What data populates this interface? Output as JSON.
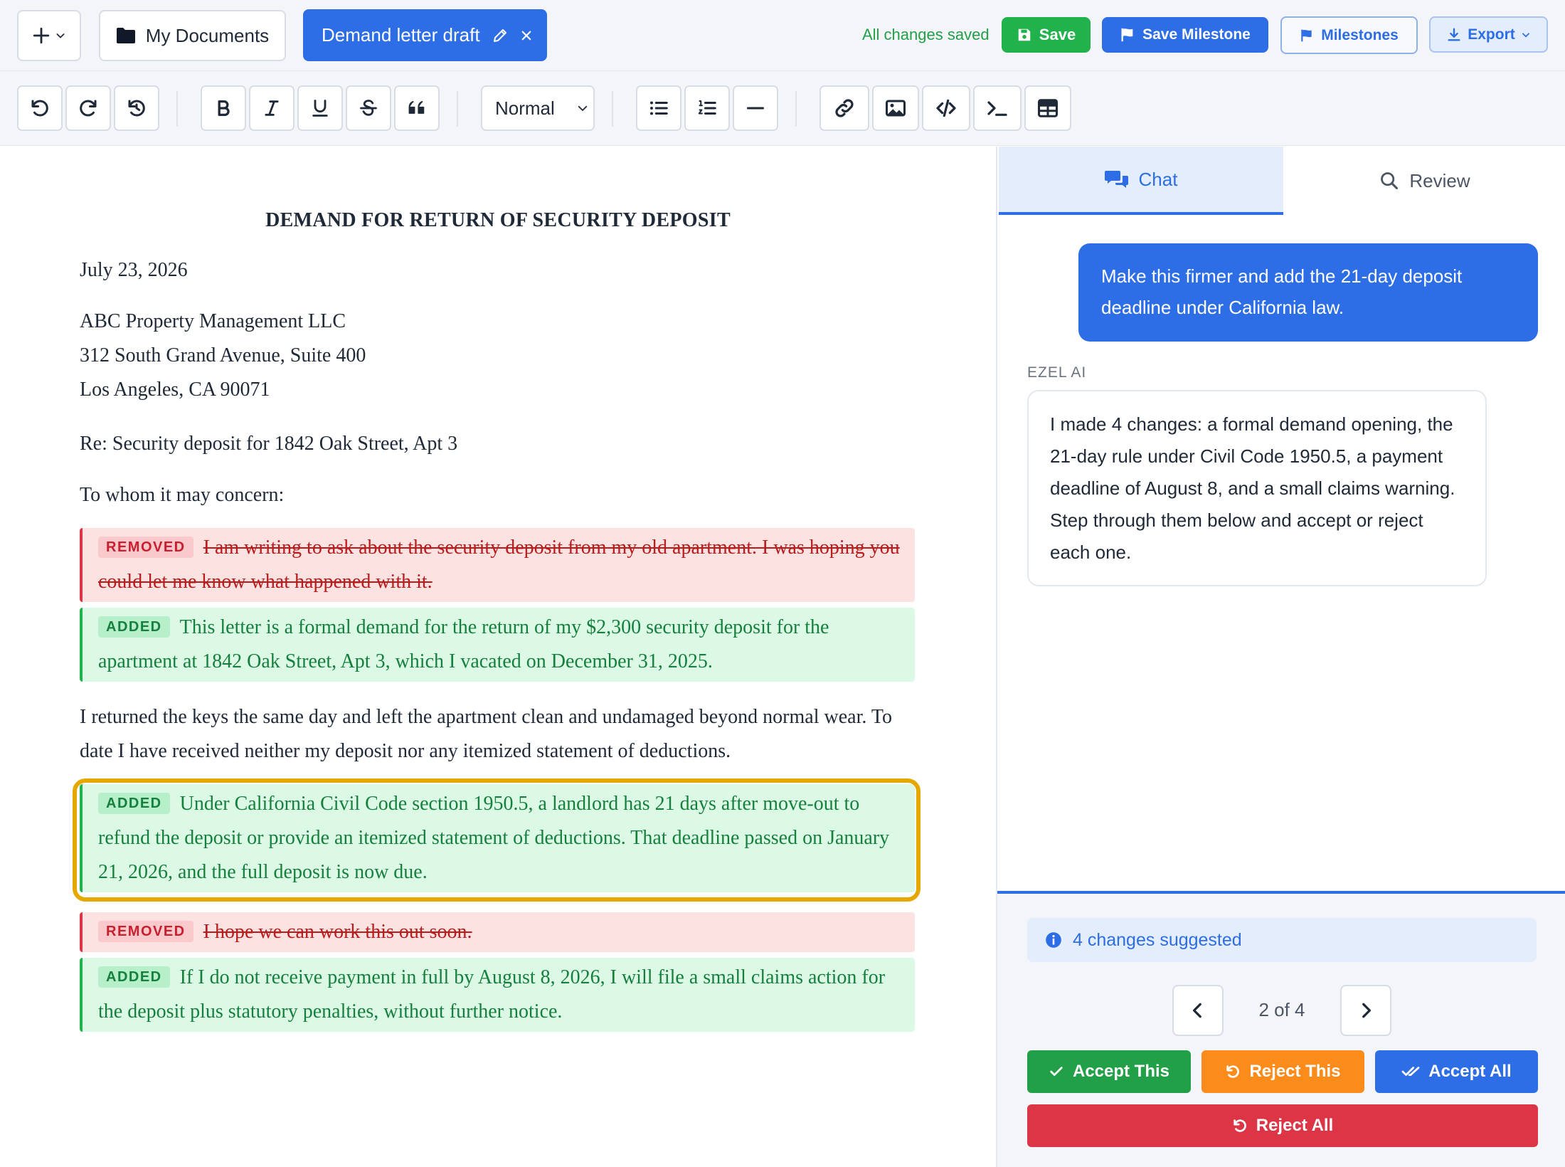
{
  "header": {
    "docs_label": "My Documents",
    "active_tab": "Demand letter draft",
    "saved_status": "All changes saved",
    "save_label": "Save",
    "save_milestone_label": "Save Milestone",
    "milestones_label": "Milestones",
    "export_label": "Export"
  },
  "toolbar": {
    "style_select": "Normal",
    "buttons": [
      "undo-icon",
      "redo-icon",
      "history-icon",
      "bold-icon",
      "italic-icon",
      "underline-icon",
      "strikethrough-icon",
      "quote-icon",
      "bullet-list-icon",
      "numbered-list-icon",
      "horizontal-rule-icon",
      "link-icon",
      "image-icon",
      "code-icon",
      "terminal-icon",
      "table-icon"
    ]
  },
  "document": {
    "title": "DEMAND FOR RETURN OF SECURITY DEPOSIT",
    "date": "July 23, 2026",
    "address": [
      "ABC Property Management LLC",
      "312 South Grand Avenue, Suite 400",
      "Los Angeles, CA 90071"
    ],
    "re": "Re: Security deposit for 1842 Oak Street, Apt 3",
    "salutation": "To whom it may concern:",
    "body_para": "I returned the keys the same day and left the apartment clean and undamaged beyond normal wear. To date I have received neither my deposit nor any itemized statement of deductions.",
    "changes": [
      {
        "type": "removed",
        "badge": "REMOVED",
        "text": "I am writing to ask about the security deposit from my old apartment. I was hoping you could let me know what happened with it."
      },
      {
        "type": "added",
        "badge": "ADDED",
        "text": "This letter is a formal demand for the return of my $2,300 security deposit for the apartment at 1842 Oak Street, Apt 3, which I vacated on December 31, 2025."
      },
      {
        "type": "added",
        "badge": "ADDED",
        "text": "Under California Civil Code section 1950.5, a landlord has 21 days after move-out to refund the deposit or provide an itemized statement of deductions. That deadline passed on January 21, 2026, and the full deposit is now due."
      },
      {
        "type": "removed",
        "badge": "REMOVED",
        "text": "I hope we can work this out soon."
      },
      {
        "type": "added",
        "badge": "ADDED",
        "text": "If I do not receive payment in full by August 8, 2026, I will file a small claims action for the deposit plus statutory penalties, without further notice."
      }
    ]
  },
  "panel": {
    "tabs": {
      "chat": "Chat",
      "review": "Review"
    },
    "user_message": "Make this firmer and add the 21-day deposit deadline under California law.",
    "ai_label": "EZEL AI",
    "ai_message": "I made 4 changes: a formal demand opening, the 21-day rule under Civil Code 1950.5, a payment deadline of August 8, and a small claims warning. Step through them below and accept or reject each one.",
    "changes_info": "4 changes suggested",
    "nav_count": "2 of 4",
    "accept_this": "Accept This",
    "reject_this": "Reject This",
    "accept_all": "Accept All",
    "reject_all": "Reject All"
  },
  "colors": {
    "accent": "#2d6ee6",
    "success": "#22b24c",
    "danger": "#dc3545",
    "warning": "#fb8c1c",
    "focus": "#e5a800"
  }
}
